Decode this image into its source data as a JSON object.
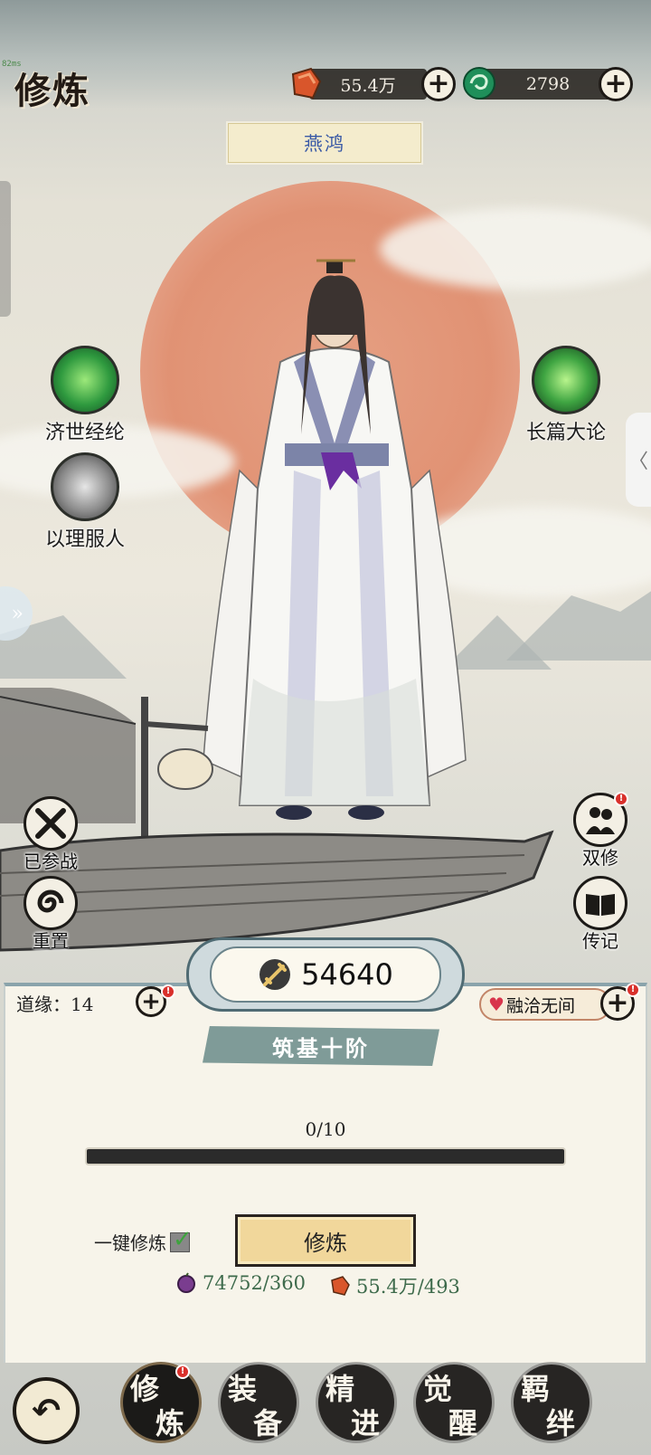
{
  "header": {
    "fps": "82ms",
    "title": "修炼",
    "currency_1": {
      "icon": "copper-ore-icon",
      "value": "55.4万"
    },
    "currency_2": {
      "icon": "jade-coin-icon",
      "value": "2798"
    },
    "plus_label": "+"
  },
  "character": {
    "name": "燕鸿"
  },
  "skills": {
    "left_1": "济世经纶",
    "left_2": "以理服人",
    "right_1": "长篇大论"
  },
  "side_buttons": {
    "battle": "已参战",
    "reset": "重置",
    "dual": "双修",
    "biography": "传记"
  },
  "right_tab_glyph": "〈",
  "panel": {
    "power": "54640",
    "dao_yuan_label": "道缘：14",
    "harmony_label": "融洽无间",
    "realm": "筑基十阶",
    "progress_text": "0/10",
    "progress_fraction": 0.0,
    "one_key_label": "一键修炼",
    "one_key_checked": true,
    "train_button": "修炼",
    "cost_1": "74752/360",
    "cost_2": "55.4万/493"
  },
  "nav": {
    "back_glyph": "↶",
    "tabs": [
      {
        "c1": "修",
        "c2": "炼",
        "active": true
      },
      {
        "c1": "装",
        "c2": "备",
        "active": false
      },
      {
        "c1": "精",
        "c2": "进",
        "active": false
      },
      {
        "c1": "觉",
        "c2": "醒",
        "active": false
      },
      {
        "c1": "羁",
        "c2": "绊",
        "active": false
      }
    ]
  },
  "colors": {
    "accent": "#7f9b98",
    "sun": "#e08b6b",
    "button": "#f1d79b",
    "name": "#3a5aa6"
  }
}
